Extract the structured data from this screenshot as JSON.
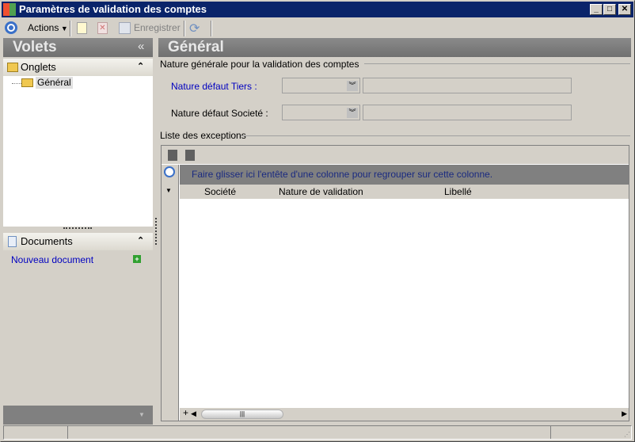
{
  "window": {
    "title": "Paramètres de validation des comptes",
    "minimize": "_",
    "maximize": "□",
    "close": "✕"
  },
  "toolbar": {
    "actions_label": "Actions",
    "save_label": "Enregistrer"
  },
  "left_panel": {
    "title": "Volets",
    "collapse": "«",
    "tabs_section": {
      "title": "Onglets",
      "items": [
        {
          "label": "Général"
        }
      ]
    },
    "documents_section": {
      "title": "Documents",
      "new_document": "Nouveau document"
    }
  },
  "main": {
    "title": "Général",
    "group_label": "Nature générale pour la validation des comptes",
    "fields": [
      {
        "label": "Nature défaut Tiers :",
        "value": "",
        "text": ""
      },
      {
        "label": "Nature défaut Societé :",
        "value": "",
        "text": ""
      }
    ],
    "exceptions": {
      "title": "Liste des exceptions",
      "group_hint": "Faire glisser ici l'entête d'une colonne pour regrouper sur cette colonne.",
      "columns": [
        "Société",
        "Nature de validation",
        "Libellé"
      ],
      "rows": [],
      "add": "+"
    }
  }
}
